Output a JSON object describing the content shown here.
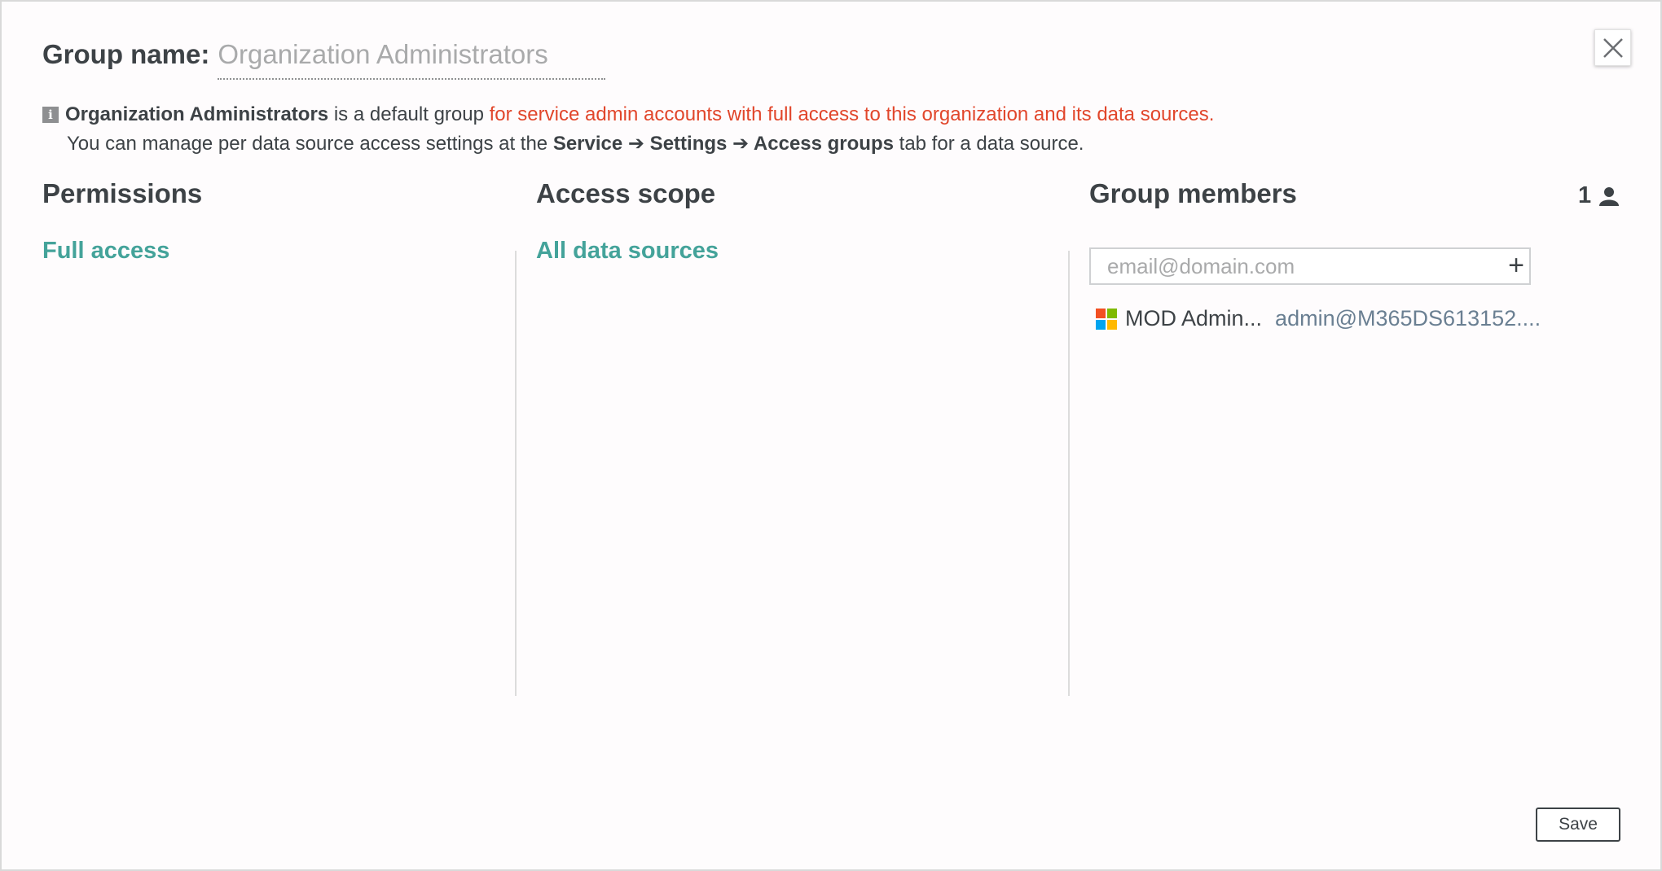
{
  "dialog": {
    "group_name_label": "Group name:",
    "group_name_value": "Organization Administrators",
    "info": {
      "icon": "info-icon",
      "line1_bold": "Organization Administrators",
      "line1_text": " is a default group ",
      "line1_highlight": "for service admin accounts with full access to this organization and its data sources.",
      "line2_text": "You can manage per data source access settings at the ",
      "line2_path": "Service ➔ Settings ➔ Access groups",
      "line2_suffix": " tab for a data source."
    },
    "close_icon": "close-icon"
  },
  "permissions": {
    "title": "Permissions",
    "value": "Full access"
  },
  "access_scope": {
    "title": "Access scope",
    "value": "All data sources"
  },
  "group_members": {
    "title": "Group members",
    "count": "1",
    "count_icon": "user-icon",
    "email_placeholder": "email@domain.com",
    "add_label": "+",
    "members": [
      {
        "name": "MOD Admin...",
        "email": "admin@M365DS613152....",
        "icon": "microsoft-logo-icon"
      }
    ]
  },
  "footer": {
    "save_label": "Save"
  },
  "colors": {
    "accent": "#44a39a",
    "highlight": "#e1462b",
    "text": "#3d4246",
    "email_link": "#6a7f92"
  }
}
